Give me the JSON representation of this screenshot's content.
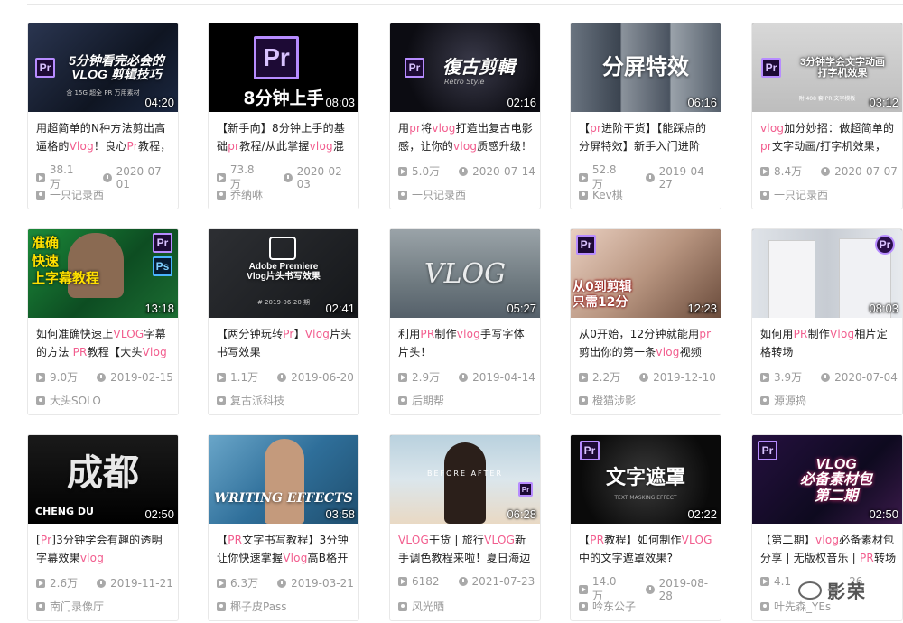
{
  "cards": [
    {
      "thumb_text": "5分钟看完必会的\nVLOG 剪辑技巧",
      "thumb_sub": "含 15G 超全 PR 万用素材",
      "duration": "04:20",
      "title": [
        [
          "用超简单的N种方法剪出高逼格的"
        ],
        [
          "Vlog",
          "hl"
        ],
        [
          "！良心"
        ],
        [
          "Pr",
          "hl"
        ],
        [
          "教程，"
        ]
      ],
      "title_text": "用超简单的N种方法剪出高逼格的Vlog！良心Pr教程，",
      "plays": "38.1万",
      "date": "2020-07-01",
      "author": "一只记录西"
    },
    {
      "thumb_text": "8分钟上手",
      "thumb_sub": "",
      "duration": "08:03",
      "title_text": "【新手向】8分钟上手的基础pr教程/从此掌握vlog混剪",
      "plays": "73.8万",
      "date": "2020-02-03",
      "author": "乔纳咻"
    },
    {
      "thumb_text": "復古剪輯",
      "thumb_sub": "Retro Style",
      "duration": "02:16",
      "title_text": "用pr将vlog打造出复古电影感，让你的vlog质感升级！",
      "plays": "5.0万",
      "date": "2020-07-14",
      "author": "一只记录西"
    },
    {
      "thumb_text": "分屏特效",
      "thumb_sub": "",
      "duration": "06:16",
      "title_text": "【pr进阶干货】【能踩点的分屏特效】新手入门进阶",
      "plays": "52.8万",
      "date": "2019-04-27",
      "author": "Kev棋"
    },
    {
      "thumb_text": "3分钟学会文字动画\n打字机效果",
      "thumb_sub": "附 408 套 PR 文字模板",
      "duration": "03:12",
      "title_text": "vlog加分妙招：做超简单的pr文字动画/打字机效果，含",
      "plays": "8.4万",
      "date": "2020-07-07",
      "author": "一只记录西"
    },
    {
      "thumb_text": "准确\n快速\n上字幕教程",
      "thumb_sub": "",
      "duration": "13:18",
      "title_text": "如何准确快速上VLOG字幕的方法 PR教程【大头Vlog",
      "plays": "9.0万",
      "date": "2019-02-15",
      "author": "大头SOLO"
    },
    {
      "thumb_text": "Adobe Premiere\nVlog片头书写效果",
      "thumb_sub": "# 2019-06-20 期",
      "duration": "02:41",
      "title_text": "【两分钟玩转Pr】Vlog片头书写效果",
      "plays": "1.1万",
      "date": "2019-06-20",
      "author": "复古派科技"
    },
    {
      "thumb_text": "VLOG",
      "thumb_sub": "",
      "duration": "05:27",
      "title_text": "利用PR制作vlog手写字体片头！",
      "plays": "2.9万",
      "date": "2019-04-14",
      "author": "后期帮"
    },
    {
      "thumb_text": "从0到剪辑\n只需12分",
      "thumb_sub": "",
      "duration": "12:23",
      "title_text": "从0开始，12分钟就能用pr剪出你的第一条vlog视频",
      "plays": "2.2万",
      "date": "2019-12-10",
      "author": "橙猫涉影"
    },
    {
      "thumb_text": "",
      "thumb_sub": "",
      "duration": "08:03",
      "title_text": "如何用PR制作Vlog相片定格转场",
      "plays": "3.9万",
      "date": "2020-07-04",
      "author": "源源捣"
    },
    {
      "thumb_text": "成都",
      "thumb_sub": "CHENG DU",
      "duration": "02:50",
      "title_text": "[Pr]3分钟学会有趣的透明字幕效果vlog",
      "plays": "2.6万",
      "date": "2019-11-21",
      "author": "南门录像厅"
    },
    {
      "thumb_text": "WRITING EFFECTS",
      "thumb_sub": "",
      "duration": "03:58",
      "title_text": "【PR文字书写教程】3分钟让你快速掌握Vlog高B格开",
      "plays": "6.3万",
      "date": "2019-03-21",
      "author": "椰子皮Pass"
    },
    {
      "thumb_text": "BEFORE    AFTER",
      "thumb_sub": "",
      "duration": "06:28",
      "title_text": "VLOG干货 | 旅行VLOG新手调色教程来啦！夏日海边旅",
      "plays": "6182",
      "date": "2021-07-23",
      "author": "风光晒"
    },
    {
      "thumb_text": "文字遮罩",
      "thumb_sub": "TEXT MASKING EFFECT",
      "duration": "02:22",
      "title_text": "【PR教程】如何制作VLOG中的文字遮罩效果?",
      "plays": "14.0万",
      "date": "2019-08-28",
      "author": "吟东公子"
    },
    {
      "thumb_text": "VLOG\n必备素材包\n第二期",
      "thumb_sub": "",
      "duration": "02:50",
      "title_text": "【第二期】vlog必备素材包分享 | 无版权音乐 | PR转场",
      "plays": "4.1",
      "date": "26",
      "author": "叶先森_YEs"
    }
  ],
  "watermark": "影荣",
  "colors": {
    "highlight": "#f25d8e",
    "meta": "#999999",
    "badge_pr": "#b78cff"
  }
}
